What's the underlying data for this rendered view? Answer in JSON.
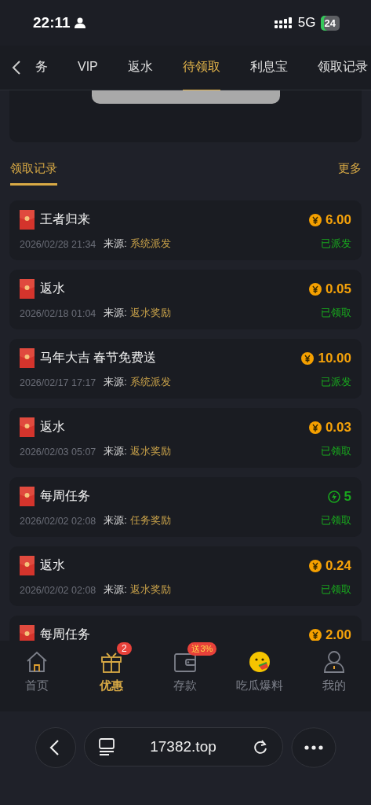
{
  "status_bar": {
    "time": "22:11",
    "network": "5G",
    "battery": "24"
  },
  "tabs": [
    {
      "label": "务",
      "selected": false
    },
    {
      "label": "VIP",
      "selected": false
    },
    {
      "label": "返水",
      "selected": false
    },
    {
      "label": "待领取",
      "selected": true
    },
    {
      "label": "利息宝",
      "selected": false
    },
    {
      "label": "领取记录",
      "selected": false
    }
  ],
  "section": {
    "title": "领取记录",
    "more": "更多"
  },
  "records": [
    {
      "title": "王者归来",
      "kind": "coin",
      "amount": "6.00",
      "date": "2026/02/28 21:34",
      "source_label": "来源:",
      "source": "系统派发",
      "status": "已派发"
    },
    {
      "title": "返水",
      "kind": "coin",
      "amount": "0.05",
      "date": "2026/02/18 01:04",
      "source_label": "来源:",
      "source": "返水奖励",
      "status": "已领取"
    },
    {
      "title": "马年大吉 春节免费送",
      "kind": "coin",
      "amount": "10.00",
      "date": "2026/02/17 17:17",
      "source_label": "来源:",
      "source": "系统派发",
      "status": "已派发"
    },
    {
      "title": "返水",
      "kind": "coin",
      "amount": "0.03",
      "date": "2026/02/03 05:07",
      "source_label": "来源:",
      "source": "返水奖励",
      "status": "已领取"
    },
    {
      "title": "每周任务",
      "kind": "bolt",
      "amount": "5",
      "date": "2026/02/02 02:08",
      "source_label": "来源:",
      "source": "任务奖励",
      "status": "已领取"
    },
    {
      "title": "返水",
      "kind": "coin",
      "amount": "0.24",
      "date": "2026/02/02 02:08",
      "source_label": "来源:",
      "source": "返水奖励",
      "status": "已领取"
    },
    {
      "title": "每周任务",
      "kind": "coin",
      "amount": "2.00"
    }
  ],
  "bottom_nav": [
    {
      "kind": "home",
      "label": "首页",
      "selected": false
    },
    {
      "kind": "gift",
      "label": "优惠",
      "selected": true,
      "badge": "2"
    },
    {
      "kind": "wallet",
      "label": "存款",
      "selected": false,
      "badge": "送3%"
    },
    {
      "kind": "emoji",
      "label": "吃瓜爆料",
      "selected": false
    },
    {
      "kind": "user",
      "label": "我的",
      "selected": false
    }
  ],
  "browser_bar": {
    "url": "17382.top"
  }
}
